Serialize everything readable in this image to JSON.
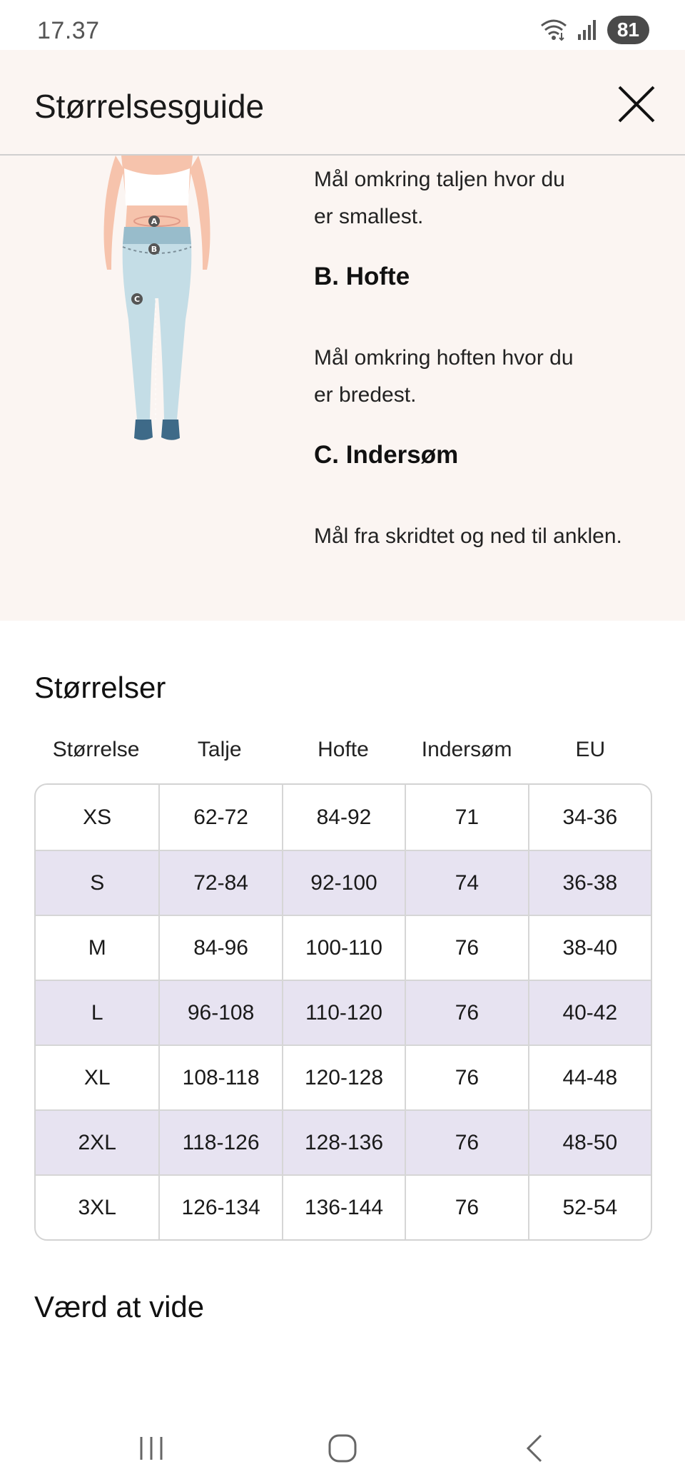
{
  "status": {
    "time": "17.37",
    "battery": "81"
  },
  "header": {
    "title": "Størrelsesguide"
  },
  "guide": {
    "a_desc_line1": "Mål omkring taljen hvor du",
    "a_desc_line2": "er smallest.",
    "b_title": "B. Hofte",
    "b_desc_line1": "Mål omkring hoften hvor du",
    "b_desc_line2": "er bredest.",
    "c_title": "C. Indersøm",
    "c_desc": "Mål fra skridtet og ned til anklen.",
    "markers": [
      "A",
      "B",
      "C"
    ]
  },
  "sizes": {
    "title": "Størrelser",
    "columns": [
      "Størrelse",
      "Talje",
      "Hofte",
      "Indersøm",
      "EU"
    ],
    "rows": [
      [
        "XS",
        "62-72",
        "84-92",
        "71",
        "34-36"
      ],
      [
        "S",
        "72-84",
        "92-100",
        "74",
        "36-38"
      ],
      [
        "M",
        "84-96",
        "100-110",
        "76",
        "38-40"
      ],
      [
        "L",
        "96-108",
        "110-120",
        "76",
        "40-42"
      ],
      [
        "XL",
        "108-118",
        "120-128",
        "76",
        "44-48"
      ],
      [
        "2XL",
        "118-126",
        "128-136",
        "76",
        "48-50"
      ],
      [
        "3XL",
        "126-134",
        "136-144",
        "76",
        "52-54"
      ]
    ]
  },
  "know": {
    "title": "Værd at vide"
  },
  "colors": {
    "panel_bg": "#fbf5f2",
    "row_alt": "#e7e3f1",
    "legging": "#c4dde6",
    "shoe": "#3e6a88",
    "skin": "#f6c3ac"
  }
}
